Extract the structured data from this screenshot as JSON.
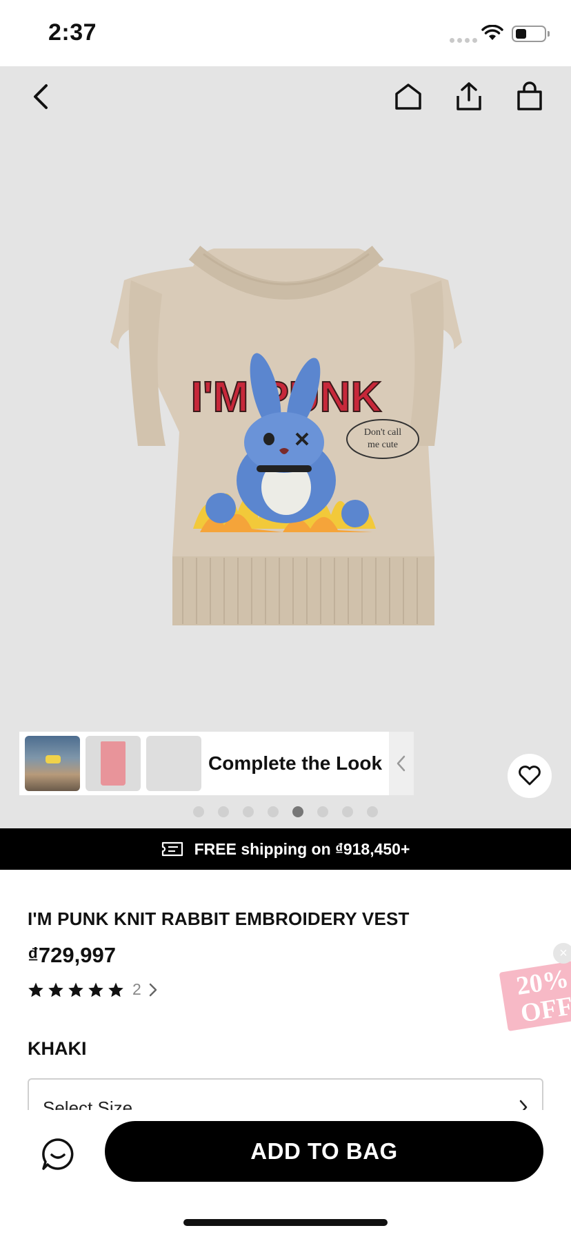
{
  "status_bar": {
    "time": "2:37"
  },
  "top_nav": {
    "icons": [
      "chevron-left-icon",
      "home-icon",
      "share-icon",
      "shopping-bag-icon"
    ]
  },
  "gallery": {
    "dots_total": 8,
    "active_dot_index": 4
  },
  "complete_the_look": {
    "label": "Complete the Look"
  },
  "shipping_banner": {
    "text": "FREE shipping on ₫918,450+"
  },
  "product": {
    "title": "I'M PUNK KNIT RABBIT EMBROIDERY VEST",
    "price": "₫729,997",
    "rating_stars": 5,
    "review_count": "2",
    "color": "KHAKI",
    "graphic": {
      "headline": "I'M PUNK",
      "speech_line1": "Don't call",
      "speech_line2": "me cute"
    }
  },
  "promo": {
    "text": "20%\nOFF",
    "close_glyph": "×"
  },
  "size_select": {
    "placeholder": "Select Size"
  },
  "bottom_bar": {
    "add_to_bag_label": "ADD TO BAG"
  },
  "colors": {
    "gallery_bg": "#e4e4e4",
    "knit": "#d9cbb8",
    "banner_bg": "#000000",
    "promo_pink": "#f7b9c6"
  }
}
